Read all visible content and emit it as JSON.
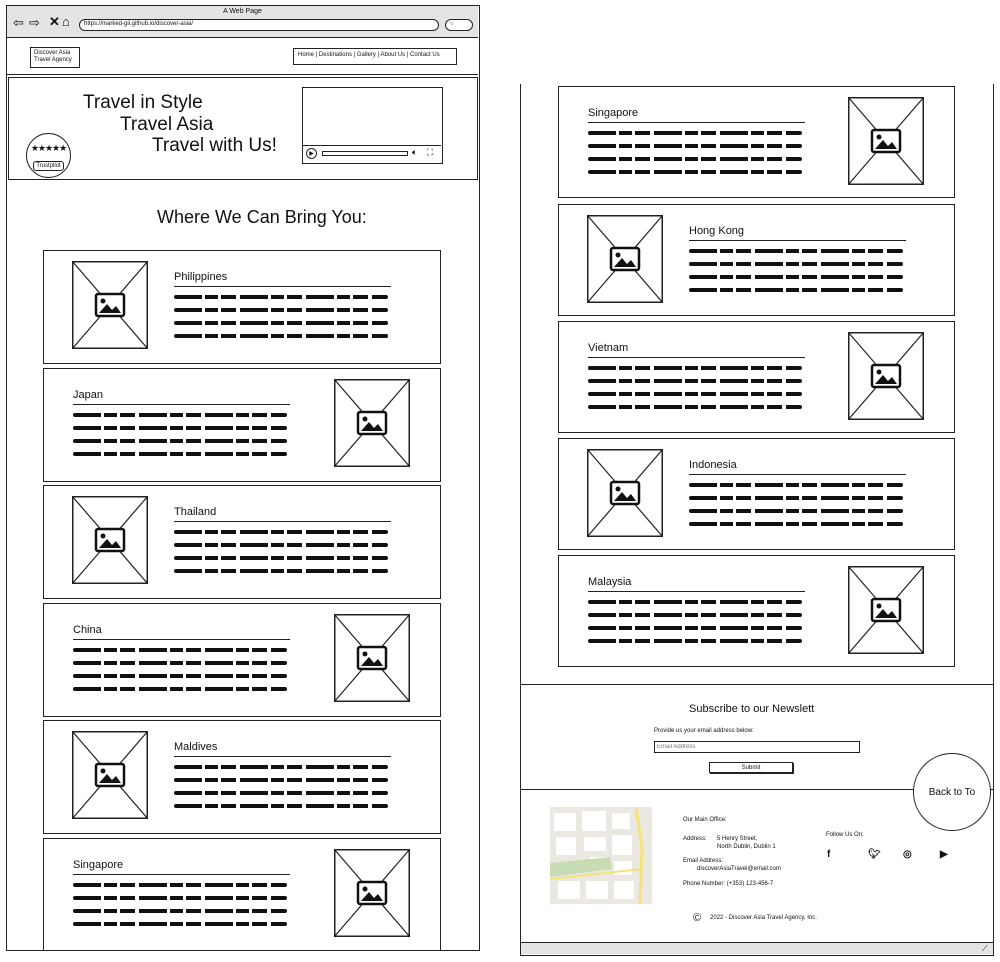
{
  "browser": {
    "window_title": "A Web Page",
    "url": "https://marked-gil.github.io/discover-asia/"
  },
  "header": {
    "logo": "Discover Asia Travel Agency",
    "nav_items": [
      "Home",
      "Destinations",
      "Gallery",
      "About Us",
      "Contact Us"
    ]
  },
  "hero": {
    "lines": [
      "Travel in Style",
      "Travel Asia",
      "Travel with Us!"
    ],
    "badge_stars": "★★★★★",
    "badge_label": "Trustpilot"
  },
  "destinations": {
    "heading": "Where We Can Bring You:",
    "left_cards": [
      "Philippines",
      "Japan",
      "Thailand",
      "China",
      "Maldives",
      "Singapore"
    ],
    "right_cards": [
      "Singapore",
      "Hong Kong",
      "Vietnam",
      "Indonesia",
      "Malaysia"
    ]
  },
  "newsletter": {
    "heading": "Subscribe to our Newslett",
    "prompt": "Provide us your email address below:",
    "email_placeholder": "Email Address",
    "submit_label": "Submit",
    "back_to_top": "Back to To"
  },
  "footer": {
    "main_office_label": "Our Main Office:",
    "address_label": "Address:",
    "address_line1": "5 Henry Street,",
    "address_line2": "North Dublin, Dublin 1",
    "email_label": "Email Address:",
    "email_value": "discoverAsiaTravel@email.com",
    "phone": "Phone Number: (+353) 123-456-7",
    "follow_label": "Follow Us On:",
    "social_icons": [
      "facebook-icon",
      "twitter-icon",
      "instagram-icon",
      "youtube-icon"
    ],
    "copyright_symbol": "©",
    "copyright": "2022 - Discover Asia Travel Agency, Inc."
  }
}
